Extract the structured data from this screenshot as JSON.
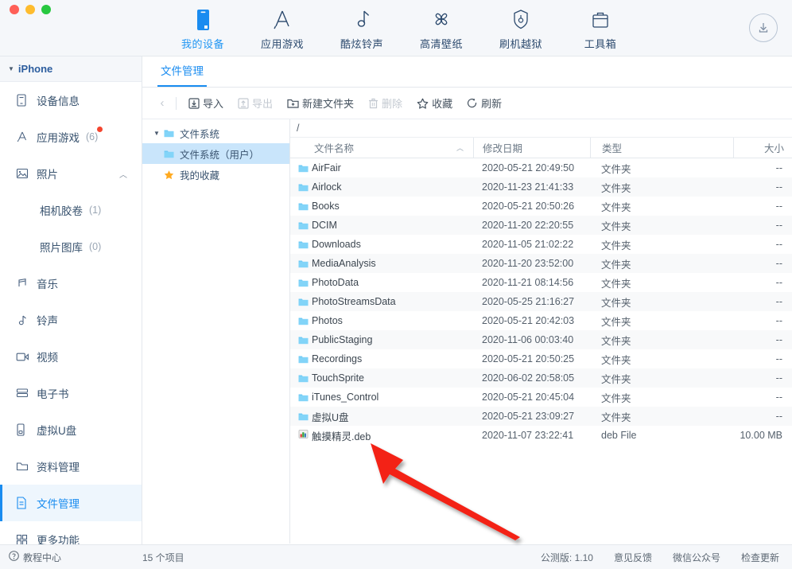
{
  "window": {
    "traffic_lights": [
      "close",
      "minimize",
      "maximize"
    ],
    "colors": {
      "accent": "#1a8cf0",
      "nav_text": "#2c4a6e",
      "selected_bg": "#eef6fd",
      "tree_selected_bg": "#c9e5fb",
      "badge": "#f4452e",
      "arrow": "#f32013"
    }
  },
  "topnav": {
    "items": [
      {
        "label": "我的设备",
        "icon": "phone-icon",
        "active": true
      },
      {
        "label": "应用游戏",
        "icon": "appstore-icon",
        "active": false
      },
      {
        "label": "酷炫铃声",
        "icon": "music-note-icon",
        "active": false
      },
      {
        "label": "高清壁纸",
        "icon": "flower-icon",
        "active": false
      },
      {
        "label": "刷机越狱",
        "icon": "shield-icon",
        "active": false
      },
      {
        "label": "工具箱",
        "icon": "toolbox-icon",
        "active": false
      }
    ],
    "download_button": "download-icon"
  },
  "sidebar": {
    "device_header": {
      "label": "iPhone",
      "caret": "▼"
    },
    "items": [
      {
        "label": "设备信息",
        "icon": "device-info-icon",
        "count": "",
        "selected": false,
        "sub": false
      },
      {
        "label": "应用游戏",
        "icon": "apps-games-icon",
        "count": "(6)",
        "selected": false,
        "sub": false,
        "badge": true
      },
      {
        "label": "照片",
        "icon": "photos-icon",
        "count": "",
        "selected": false,
        "sub": false,
        "chevron": "︿"
      },
      {
        "label": "相机胶卷",
        "icon": "",
        "count": "(1)",
        "selected": false,
        "sub": true
      },
      {
        "label": "照片图库",
        "icon": "",
        "count": "(0)",
        "selected": false,
        "sub": true
      },
      {
        "label": "音乐",
        "icon": "music-icon",
        "count": "",
        "selected": false,
        "sub": false
      },
      {
        "label": "铃声",
        "icon": "ringtone-icon",
        "count": "",
        "selected": false,
        "sub": false
      },
      {
        "label": "视频",
        "icon": "video-icon",
        "count": "",
        "selected": false,
        "sub": false
      },
      {
        "label": "电子书",
        "icon": "ebook-icon",
        "count": "",
        "selected": false,
        "sub": false
      },
      {
        "label": "虚拟U盘",
        "icon": "usb-drive-icon",
        "count": "",
        "selected": false,
        "sub": false
      },
      {
        "label": "资料管理",
        "icon": "data-folder-icon",
        "count": "",
        "selected": false,
        "sub": false
      },
      {
        "label": "文件管理",
        "icon": "file-manager-icon",
        "count": "",
        "selected": true,
        "sub": false
      },
      {
        "label": "更多功能",
        "icon": "more-features-icon",
        "count": "",
        "selected": false,
        "sub": false
      }
    ]
  },
  "content": {
    "tab": "文件管理",
    "toolbar": {
      "back": "‹",
      "buttons": [
        {
          "label": "导入",
          "icon": "import-icon",
          "disabled": false
        },
        {
          "label": "导出",
          "icon": "export-icon",
          "disabled": true
        },
        {
          "label": "新建文件夹",
          "icon": "new-folder-icon",
          "disabled": false
        },
        {
          "label": "删除",
          "icon": "trash-icon",
          "disabled": true
        },
        {
          "label": "收藏",
          "icon": "star-icon",
          "disabled": false
        },
        {
          "label": "刷新",
          "icon": "refresh-icon",
          "disabled": false
        }
      ]
    },
    "tree": [
      {
        "label": "文件系统",
        "caret": "▼",
        "icon": "folder-icon",
        "selected": false,
        "child": false
      },
      {
        "label": "文件系统（用户）",
        "caret": "",
        "icon": "folder-icon",
        "selected": true,
        "child": true
      },
      {
        "label": "我的收藏",
        "caret": "",
        "icon": "star-filled-icon",
        "selected": false,
        "child": false
      }
    ],
    "path": "/",
    "table": {
      "headers": {
        "name": "文件名称",
        "sort": "︿",
        "date": "修改日期",
        "type": "类型",
        "size": "大小"
      },
      "rows": [
        {
          "name": "AirFair",
          "date": "2020-05-21 20:49:50",
          "type": "文件夹",
          "size": "--",
          "icon": "folder-icon"
        },
        {
          "name": "Airlock",
          "date": "2020-11-23 21:41:33",
          "type": "文件夹",
          "size": "--",
          "icon": "folder-icon"
        },
        {
          "name": "Books",
          "date": "2020-05-21 20:50:26",
          "type": "文件夹",
          "size": "--",
          "icon": "folder-icon"
        },
        {
          "name": "DCIM",
          "date": "2020-11-20 22:20:55",
          "type": "文件夹",
          "size": "--",
          "icon": "folder-icon"
        },
        {
          "name": "Downloads",
          "date": "2020-11-05 21:02:22",
          "type": "文件夹",
          "size": "--",
          "icon": "folder-icon"
        },
        {
          "name": "MediaAnalysis",
          "date": "2020-11-20 23:52:00",
          "type": "文件夹",
          "size": "--",
          "icon": "folder-icon"
        },
        {
          "name": "PhotoData",
          "date": "2020-11-21 08:14:56",
          "type": "文件夹",
          "size": "--",
          "icon": "folder-icon"
        },
        {
          "name": "PhotoStreamsData",
          "date": "2020-05-25 21:16:27",
          "type": "文件夹",
          "size": "--",
          "icon": "folder-icon"
        },
        {
          "name": "Photos",
          "date": "2020-05-21 20:42:03",
          "type": "文件夹",
          "size": "--",
          "icon": "folder-icon"
        },
        {
          "name": "PublicStaging",
          "date": "2020-11-06 00:03:40",
          "type": "文件夹",
          "size": "--",
          "icon": "folder-icon"
        },
        {
          "name": "Recordings",
          "date": "2020-05-21 20:50:25",
          "type": "文件夹",
          "size": "--",
          "icon": "folder-icon"
        },
        {
          "name": "TouchSprite",
          "date": "2020-06-02 20:58:05",
          "type": "文件夹",
          "size": "--",
          "icon": "folder-icon"
        },
        {
          "name": "iTunes_Control",
          "date": "2020-05-21 20:45:04",
          "type": "文件夹",
          "size": "--",
          "icon": "folder-icon"
        },
        {
          "name": "虚拟U盘",
          "date": "2020-05-21 23:09:27",
          "type": "文件夹",
          "size": "--",
          "icon": "folder-icon"
        },
        {
          "name": "触摸精灵.deb",
          "date": "2020-11-07 23:22:41",
          "type": "deb File",
          "size": "10.00 MB",
          "icon": "deb-file-icon"
        }
      ]
    }
  },
  "statusbar": {
    "help": "教程中心",
    "item_count": "15 个项目",
    "version": "公测版: 1.10",
    "feedback": "意见反馈",
    "wechat": "微信公众号",
    "update": "检查更新"
  }
}
